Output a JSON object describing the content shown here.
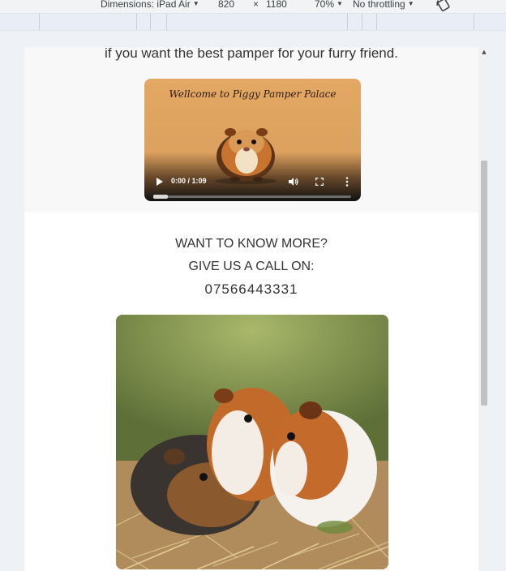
{
  "devtools": {
    "dimensions_label": "Dimensions: iPad Air",
    "width": "820",
    "times": "×",
    "height": "1180",
    "zoom": "70%",
    "throttling": "No throttling"
  },
  "page": {
    "hero_text": "if you want the best pamper for your furry friend.",
    "video": {
      "title": "Wellcome to Piggy Pamper Palace",
      "time": "0:00 / 1:09",
      "progress": 0.0
    },
    "contact": {
      "line1": "WANT TO KNOW MORE?",
      "line2": "GIVE US A CALL ON:",
      "phone": "07566443331"
    }
  },
  "colors": {
    "video_bg": "#dfa561",
    "page_bg": "#ffffff",
    "hero_bg": "#f8f8f8",
    "text": "#333333"
  }
}
